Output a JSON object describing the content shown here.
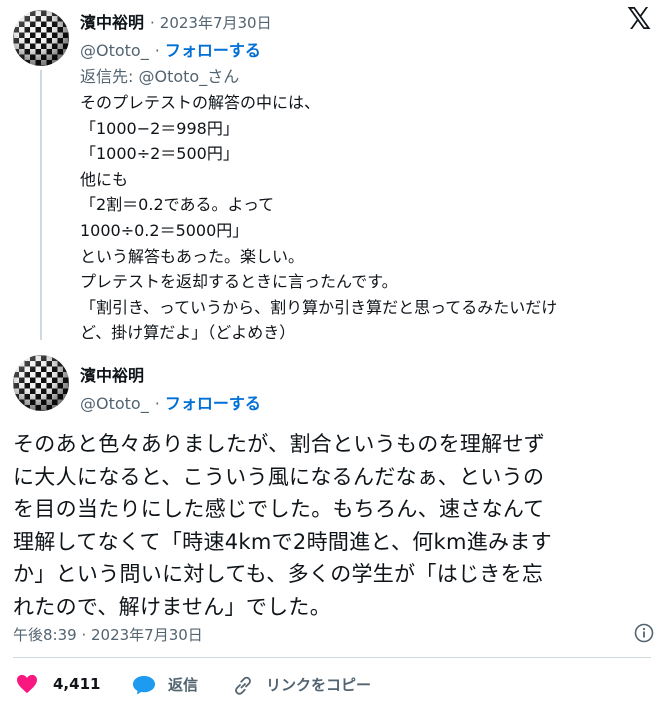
{
  "reply_tweet": {
    "author_name": "濱中裕明",
    "sep": "·",
    "date": "2023年7月30日",
    "handle": "@Ototo_",
    "follow_label": "フォローする",
    "reply_to": "返信先: @Ototo_さん",
    "text": "そのプレテストの解答の中には、\n「1000−2＝998円」\n「1000÷2＝500円」\n他にも\n「2割＝0.2である。よって\n1000÷0.2＝5000円」\nという解答もあった。楽しい。\nプレテストを返却するときに言ったんです。\n「割引き、っていうから、割り算か引き算だと思ってるみたいだけ\nど、掛け算だよ」（どよめき）"
  },
  "main_tweet": {
    "author_name": "濱中裕明",
    "handle": "@Ototo_",
    "sep": "·",
    "follow_label": "フォローする",
    "text": "そのあと色々ありましたが、割合というものを理解せず\nに大人になると、こういう風になるんだなぁ、というの\nを目の当たりにした感じでした。もちろん、速さなんて\n理解してなくて「時速4kmで2時間進と、何km進みます\nか」という問いに対しても、多くの学生が「はじきを忘\nれたので、解けません」でした。",
    "timestamp": "午後8:39 · 2023年7月30日"
  },
  "actions": {
    "like_count": "4,411",
    "reply_label": "返信",
    "copy_link_label": "リンクをコピー"
  },
  "logo": "𝕏",
  "colors": {
    "like": "#f91880",
    "reply": "#1d9bf0",
    "link": "#006fd6",
    "muted": "#536471"
  },
  "icons": [
    "x-logo-icon",
    "info-icon",
    "heart-icon",
    "reply-bubble-icon",
    "link-icon"
  ]
}
